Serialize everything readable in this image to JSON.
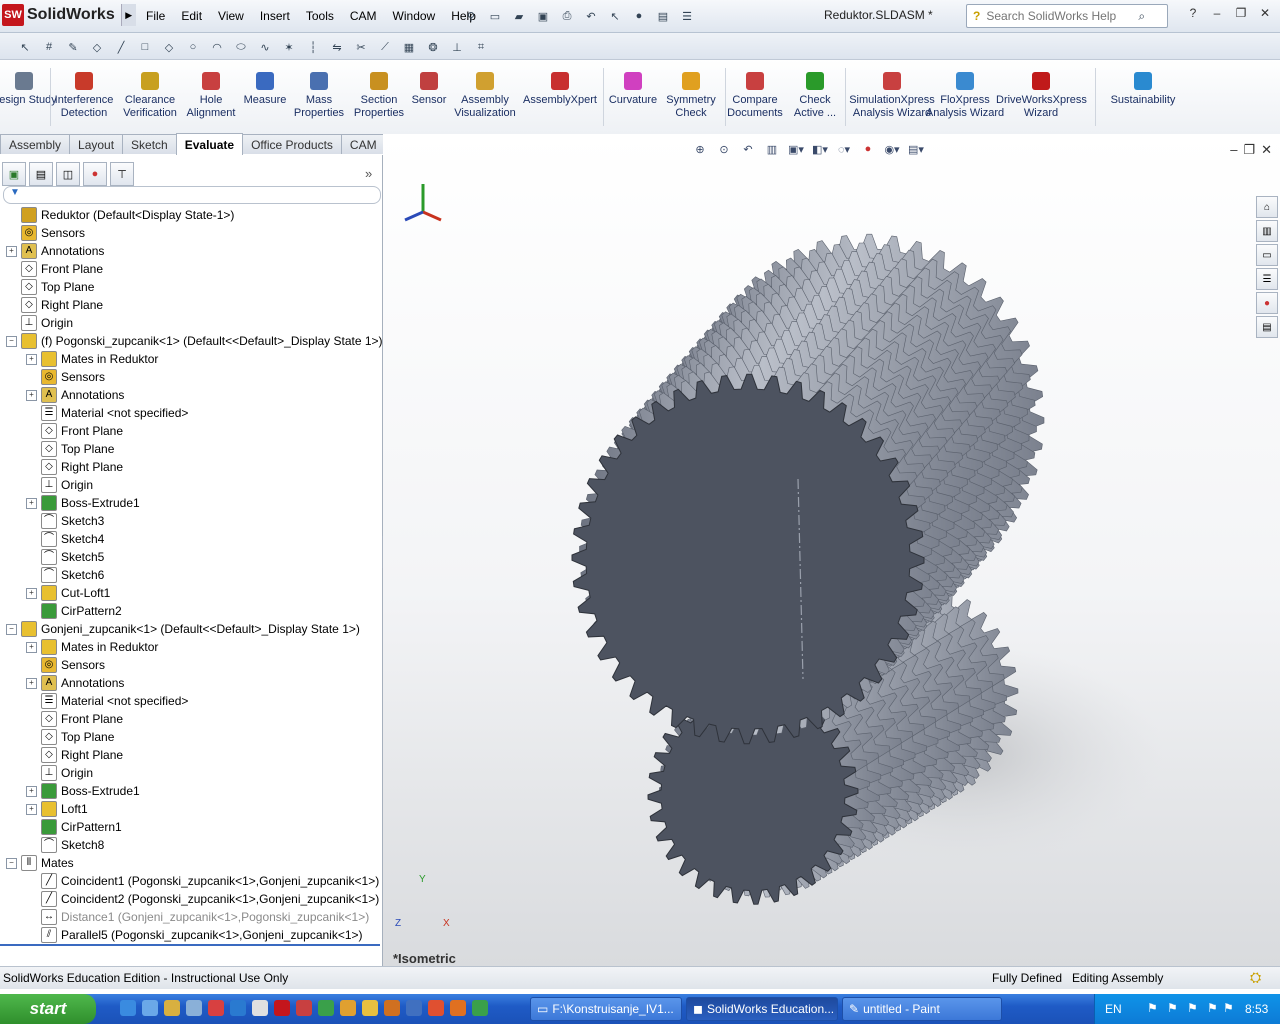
{
  "app": {
    "brand": "SolidWorks",
    "document_title": "Reduktor.SLDASM *"
  },
  "menu": [
    "File",
    "Edit",
    "View",
    "Insert",
    "Tools",
    "CAM",
    "Window",
    "Help"
  ],
  "search": {
    "placeholder": "Search SolidWorks Help"
  },
  "commands": [
    {
      "label": "Design Study",
      "line2": ""
    },
    {
      "label": "Interference",
      "line2": "Detection"
    },
    {
      "label": "Clearance",
      "line2": "Verification"
    },
    {
      "label": "Hole",
      "line2": "Alignment"
    },
    {
      "label": "Measure",
      "line2": ""
    },
    {
      "label": "Mass",
      "line2": "Properties"
    },
    {
      "label": "Section",
      "line2": "Properties"
    },
    {
      "label": "Sensor",
      "line2": ""
    },
    {
      "label": "Assembly",
      "line2": "Visualization"
    },
    {
      "label": "AssemblyXpert",
      "line2": ""
    },
    {
      "label": "Curvature",
      "line2": ""
    },
    {
      "label": "Symmetry",
      "line2": "Check"
    },
    {
      "label": "Compare",
      "line2": "Documents"
    },
    {
      "label": "Check",
      "line2": "Active ..."
    },
    {
      "label": "SimulationXpress",
      "line2": "Analysis Wizard"
    },
    {
      "label": "FloXpress",
      "line2": "Analysis Wizard"
    },
    {
      "label": "DriveWorksXpress",
      "line2": "Wizard"
    },
    {
      "label": "Sustainability",
      "line2": ""
    }
  ],
  "tabs": [
    "Assembly",
    "Layout",
    "Sketch",
    "Evaluate",
    "Office Products",
    "CAM"
  ],
  "active_tab": "Evaluate",
  "tree": [
    {
      "indent": 0,
      "exp": "",
      "label": "Reduktor  (Default<Display State-1>)",
      "icon": "assembly-icon"
    },
    {
      "indent": 1,
      "exp": "",
      "label": "Sensors",
      "icon": "sensors-icon"
    },
    {
      "indent": 1,
      "exp": "+",
      "label": "Annotations",
      "icon": "annotations-icon"
    },
    {
      "indent": 1,
      "exp": "",
      "label": "Front Plane",
      "icon": "plane-icon"
    },
    {
      "indent": 1,
      "exp": "",
      "label": "Top Plane",
      "icon": "plane-icon"
    },
    {
      "indent": 1,
      "exp": "",
      "label": "Right Plane",
      "icon": "plane-icon"
    },
    {
      "indent": 1,
      "exp": "",
      "label": "Origin",
      "icon": "origin-icon"
    },
    {
      "indent": 1,
      "exp": "-",
      "label": "(f) Pogonski_zupcanik<1> (Default<<Default>_Display State 1>)",
      "icon": "part-icon"
    },
    {
      "indent": 2,
      "exp": "+",
      "label": "Mates in Reduktor",
      "icon": "mates-folder-icon"
    },
    {
      "indent": 2,
      "exp": "",
      "label": "Sensors",
      "icon": "sensors-icon"
    },
    {
      "indent": 2,
      "exp": "+",
      "label": "Annotations",
      "icon": "annotations-icon"
    },
    {
      "indent": 2,
      "exp": "",
      "label": "Material <not specified>",
      "icon": "material-icon"
    },
    {
      "indent": 2,
      "exp": "",
      "label": "Front Plane",
      "icon": "plane-icon"
    },
    {
      "indent": 2,
      "exp": "",
      "label": "Top Plane",
      "icon": "plane-icon"
    },
    {
      "indent": 2,
      "exp": "",
      "label": "Right Plane",
      "icon": "plane-icon"
    },
    {
      "indent": 2,
      "exp": "",
      "label": "Origin",
      "icon": "origin-icon"
    },
    {
      "indent": 2,
      "exp": "+",
      "label": "Boss-Extrude1",
      "icon": "extrude-icon"
    },
    {
      "indent": 2,
      "exp": "",
      "label": "Sketch3",
      "icon": "sketch-icon"
    },
    {
      "indent": 2,
      "exp": "",
      "label": "Sketch4",
      "icon": "sketch-icon"
    },
    {
      "indent": 2,
      "exp": "",
      "label": "Sketch5",
      "icon": "sketch-icon"
    },
    {
      "indent": 2,
      "exp": "",
      "label": "Sketch6",
      "icon": "sketch-icon"
    },
    {
      "indent": 2,
      "exp": "+",
      "label": "Cut-Loft1",
      "icon": "loft-icon"
    },
    {
      "indent": 2,
      "exp": "",
      "label": "CirPattern2",
      "icon": "pattern-icon"
    },
    {
      "indent": 1,
      "exp": "-",
      "label": "Gonjeni_zupcanik<1> (Default<<Default>_Display State 1>)",
      "icon": "part-icon"
    },
    {
      "indent": 2,
      "exp": "+",
      "label": "Mates in Reduktor",
      "icon": "mates-folder-icon"
    },
    {
      "indent": 2,
      "exp": "",
      "label": "Sensors",
      "icon": "sensors-icon"
    },
    {
      "indent": 2,
      "exp": "+",
      "label": "Annotations",
      "icon": "annotations-icon"
    },
    {
      "indent": 2,
      "exp": "",
      "label": "Material <not specified>",
      "icon": "material-icon"
    },
    {
      "indent": 2,
      "exp": "",
      "label": "Front Plane",
      "icon": "plane-icon"
    },
    {
      "indent": 2,
      "exp": "",
      "label": "Top Plane",
      "icon": "plane-icon"
    },
    {
      "indent": 2,
      "exp": "",
      "label": "Right Plane",
      "icon": "plane-icon"
    },
    {
      "indent": 2,
      "exp": "",
      "label": "Origin",
      "icon": "origin-icon"
    },
    {
      "indent": 2,
      "exp": "+",
      "label": "Boss-Extrude1",
      "icon": "extrude-icon"
    },
    {
      "indent": 2,
      "exp": "+",
      "label": "Loft1",
      "icon": "loft-icon"
    },
    {
      "indent": 2,
      "exp": "",
      "label": "CirPattern1",
      "icon": "pattern-icon"
    },
    {
      "indent": 2,
      "exp": "",
      "label": "Sketch8",
      "icon": "sketch-icon"
    },
    {
      "indent": 0,
      "exp": "-",
      "label": "Mates",
      "icon": "mates-icon"
    },
    {
      "indent": 2,
      "exp": "",
      "label": "Coincident1 (Pogonski_zupcanik<1>,Gonjeni_zupcanik<1>)",
      "icon": "coincident-icon"
    },
    {
      "indent": 2,
      "exp": "",
      "label": "Coincident2 (Pogonski_zupcanik<1>,Gonjeni_zupcanik<1>)",
      "icon": "coincident-icon"
    },
    {
      "indent": 2,
      "exp": "",
      "label": "Distance1 (Gonjeni_zupcanik<1>,Pogonski_zupcanik<1>)",
      "icon": "distance-icon",
      "muted": true
    },
    {
      "indent": 2,
      "exp": "",
      "label": "Parallel5 (Pogonski_zupcanik<1>,Gonjeni_zupcanik<1>)",
      "icon": "parallel-icon"
    }
  ],
  "viewport": {
    "view_label": "*Isometric",
    "axis_x": "X",
    "axis_y": "Y",
    "axis_z": "Z"
  },
  "status": {
    "left": "SolidWorks Education Edition - Instructional Use Only",
    "state": "Fully Defined",
    "mode": "Editing Assembly"
  },
  "taskbar": {
    "start": "start",
    "buttons": [
      {
        "label": "F:\\Konstruisanje_IV1..."
      },
      {
        "label": "SolidWorks Education..."
      },
      {
        "label": "untitled - Paint"
      }
    ],
    "lang": "EN",
    "clock": "8:53"
  },
  "colors": {
    "gear_face": "#4d5360",
    "gear_teeth": "#8c92a0",
    "accent": "#1b52b8"
  }
}
